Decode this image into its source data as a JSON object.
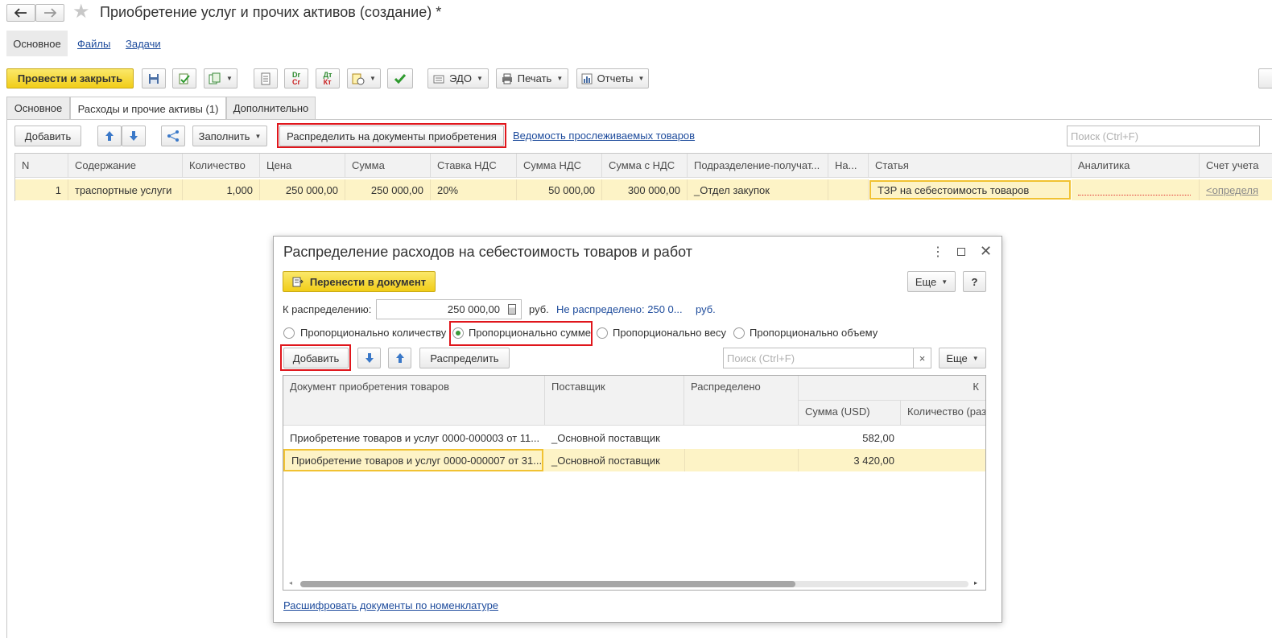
{
  "window": {
    "title": "Приобретение услуг и прочих активов (создание) *"
  },
  "nav_tabs": [
    "Основное",
    "Файлы",
    "Задачи"
  ],
  "toolbar": {
    "post_close": "Провести и закрыть",
    "edo": "ЭДО",
    "print": "Печать",
    "reports": "Отчеты"
  },
  "form_tabs": [
    "Основное",
    "Расходы и прочие активы (1)",
    "Дополнительно"
  ],
  "table_toolbar": {
    "add": "Добавить",
    "fill": "Заполнить",
    "distribute": "Распределить на документы приобретения",
    "tracked_link": "Ведомость прослеживаемых товаров",
    "search_placeholder": "Поиск (Ctrl+F)"
  },
  "table": {
    "headers": [
      "N",
      "Содержание",
      "Количество",
      "Цена",
      "Сумма",
      "Ставка НДС",
      "Сумма НДС",
      "Сумма с НДС",
      "Подразделение-получат...",
      "На...",
      "Статья",
      "Аналитика",
      "Счет учета"
    ],
    "row": [
      "1",
      "траспортные услуги",
      "1,000",
      "250 000,00",
      "250 000,00",
      "20%",
      "50 000,00",
      "300 000,00",
      "_Отдел закупок",
      "",
      "ТЗР на себестоимость товаров",
      "",
      "<определя"
    ]
  },
  "dialog": {
    "title": "Распределение расходов на себестоимость товаров и работ",
    "transfer_btn": "Перенести в документ",
    "more": "Еще",
    "help": "?",
    "to_distribute_label": "К распределению:",
    "to_distribute_value": "250 000,00",
    "currency": "руб.",
    "not_distributed": "Не распределено: 250 0...",
    "not_distributed_currency": "руб.",
    "radios": [
      "Пропорционально количеству",
      "Пропорционально сумме",
      "Пропорционально весу",
      "Пропорционально объему"
    ],
    "add": "Добавить",
    "distribute": "Распределить",
    "search_placeholder": "Поиск (Ctrl+F)",
    "search_clear": "×",
    "more2": "Еще",
    "headers": {
      "doc": "Документ приобретения товаров",
      "supplier": "Поставщик",
      "distributed": "Распределено",
      "group": "К",
      "sum": "Сумма (USD)",
      "qty": "Количество (раз"
    },
    "rows": [
      {
        "doc": "Приобретение товаров и услуг 0000-000003 от 11...",
        "supplier": "_Основной поставщик",
        "distributed": "",
        "sum": "582,00",
        "qty": ""
      },
      {
        "doc": "Приобретение товаров и услуг 0000-000007 от 31...",
        "supplier": "_Основной поставщик",
        "distributed": "",
        "sum": "3 420,00",
        "qty": ""
      }
    ],
    "bottom_link": "Расшифровать документы по номенклатуре"
  }
}
